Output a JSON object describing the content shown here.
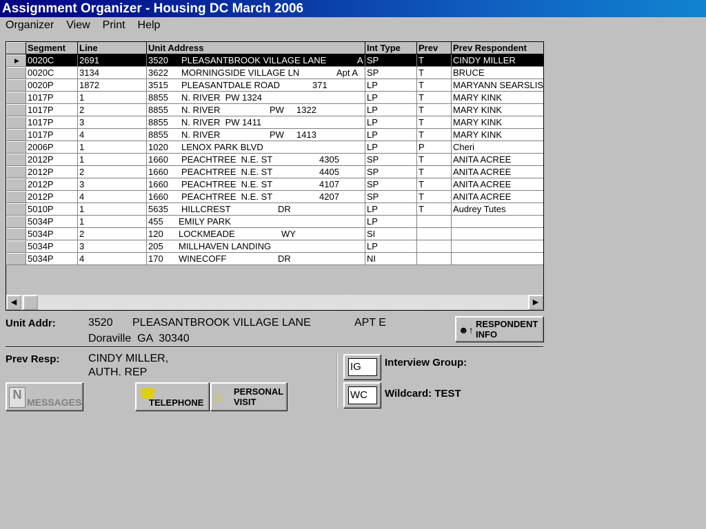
{
  "window": {
    "title": "Assignment Organizer - Housing DC March 2006"
  },
  "menu": [
    "Organizer",
    "View",
    "Print",
    "Help"
  ],
  "grid": {
    "columns": [
      "Segment",
      "Line",
      "Unit Address",
      "Int Type",
      "Prev",
      "Prev Respondent"
    ],
    "rows": [
      {
        "segment": "0020C",
        "line": "2691",
        "num": "3520",
        "street": "PLEASANTBROOK VILLAGE LANE",
        "unit": "A",
        "int_type": "SP",
        "prev": "T",
        "resp": "CINDY MILLER",
        "selected": true
      },
      {
        "segment": "0020C",
        "line": "3134",
        "num": "3622",
        "street": "MORNINGSIDE VILLAGE LN",
        "unit": "Apt A",
        "int_type": "SP",
        "prev": "T",
        "resp": "BRUCE"
      },
      {
        "segment": "0020P",
        "line": "1872",
        "num": "3515",
        "street": "PLEASANTDALE ROAD",
        "unit": "371",
        "int_type": "LP",
        "prev": "T",
        "resp": "MARYANN SEARSLIS"
      },
      {
        "segment": "1017P",
        "line": "1",
        "num": "8855",
        "street": "N. RIVER  PW 1324",
        "unit": "",
        "int_type": "LP",
        "prev": "T",
        "resp": "MARY KINK"
      },
      {
        "segment": "1017P",
        "line": "2",
        "num": "8855",
        "street": "N. RIVER",
        "unit": "PW     1322",
        "int_type": "LP",
        "prev": "T",
        "resp": "MARY KINK"
      },
      {
        "segment": "1017P",
        "line": "3",
        "num": "8855",
        "street": "N. RIVER  PW 1411",
        "unit": "",
        "int_type": "LP",
        "prev": "T",
        "resp": "MARY KINK"
      },
      {
        "segment": "1017P",
        "line": "4",
        "num": "8855",
        "street": "N. RIVER",
        "unit": "PW     1413",
        "int_type": "LP",
        "prev": "T",
        "resp": "MARY KINK"
      },
      {
        "segment": "2006P",
        "line": "1",
        "num": "1020",
        "street": "LENOX PARK BLVD",
        "unit": "",
        "int_type": "LP",
        "prev": "P",
        "resp": "Cheri"
      },
      {
        "segment": "2012P",
        "line": "1",
        "num": "1660",
        "street": "PEACHTREE  N.E. ST",
        "unit": "4305",
        "int_type": "SP",
        "prev": "T",
        "resp": "ANITA ACREE"
      },
      {
        "segment": "2012P",
        "line": "2",
        "num": "1660",
        "street": "PEACHTREE  N.E. ST",
        "unit": "4405",
        "int_type": "SP",
        "prev": "T",
        "resp": "ANITA ACREE"
      },
      {
        "segment": "2012P",
        "line": "3",
        "num": "1660",
        "street": "PEACHTREE  N.E. ST",
        "unit": "4107",
        "int_type": "SP",
        "prev": "T",
        "resp": "ANITA ACREE"
      },
      {
        "segment": "2012P",
        "line": "4",
        "num": "1660",
        "street": "PEACHTREE  N.E. ST",
        "unit": "4207",
        "int_type": "SP",
        "prev": "T",
        "resp": "ANITA ACREE"
      },
      {
        "segment": "5010P",
        "line": "1",
        "num": "5635",
        "street": "HILLCREST",
        "unit": "DR",
        "int_type": "LP",
        "prev": "T",
        "resp": "Audrey Tutes"
      },
      {
        "segment": "5034P",
        "line": "1",
        "num": "455",
        "street": "EMILY PARK",
        "unit": "",
        "int_type": "LP",
        "prev": "",
        "resp": ""
      },
      {
        "segment": "5034P",
        "line": "2",
        "num": "120",
        "street": "LOCKMEADE",
        "unit": "WY",
        "int_type": "SI",
        "prev": "",
        "resp": ""
      },
      {
        "segment": "5034P",
        "line": "3",
        "num": "205",
        "street": "MILLHAVEN LANDING",
        "unit": "",
        "int_type": "LP",
        "prev": "",
        "resp": ""
      },
      {
        "segment": "5034P",
        "line": "4",
        "num": "170",
        "street": "WINECOFF",
        "unit": "DR",
        "int_type": "NI",
        "prev": "",
        "resp": ""
      }
    ]
  },
  "detail": {
    "unit_addr_label": "Unit Addr:",
    "num": "3520",
    "street": "PLEASANTBROOK VILLAGE LANE",
    "apt": "APT E",
    "city_line": "Doraville  GA  30340",
    "prev_resp_label": "Prev Resp:",
    "prev_resp_1": "CINDY MILLER,",
    "prev_resp_2": "AUTH. REP",
    "interview_group_label": "Interview Group:",
    "wildcard_label": "Wildcard: TEST"
  },
  "buttons": {
    "respondent_1": "RESPONDENT",
    "respondent_2": "INFO",
    "messages": "MESSAGES",
    "telephone": "TELEPHONE",
    "personal_1": "PERSONAL",
    "personal_2": "VISIT",
    "ig": "IG",
    "wc": "WC"
  }
}
